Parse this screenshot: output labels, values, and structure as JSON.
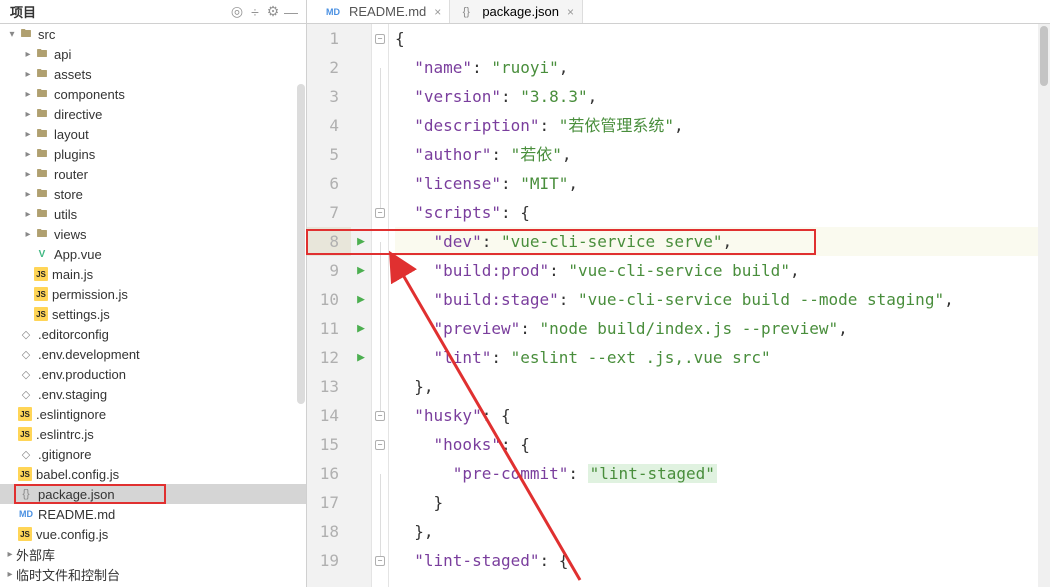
{
  "sidebar_title": "项目",
  "tabs": [
    {
      "label": "README.md",
      "icon": "md"
    },
    {
      "label": "package.json",
      "icon": "json",
      "active": true
    }
  ],
  "tree": [
    {
      "depth": 0,
      "icon": "folder",
      "label": "src",
      "expand": true
    },
    {
      "depth": 1,
      "icon": "folder",
      "label": "api",
      "arrow": true
    },
    {
      "depth": 1,
      "icon": "folder",
      "label": "assets",
      "arrow": true
    },
    {
      "depth": 1,
      "icon": "folder",
      "label": "components",
      "arrow": true
    },
    {
      "depth": 1,
      "icon": "folder",
      "label": "directive",
      "arrow": true
    },
    {
      "depth": 1,
      "icon": "folder",
      "label": "layout",
      "arrow": true
    },
    {
      "depth": 1,
      "icon": "folder",
      "label": "plugins",
      "arrow": true
    },
    {
      "depth": 1,
      "icon": "folder",
      "label": "router",
      "arrow": true
    },
    {
      "depth": 1,
      "icon": "folder",
      "label": "store",
      "arrow": true
    },
    {
      "depth": 1,
      "icon": "folder",
      "label": "utils",
      "arrow": true
    },
    {
      "depth": 1,
      "icon": "folder",
      "label": "views",
      "arrow": true
    },
    {
      "depth": 1,
      "icon": "vue",
      "label": "App.vue"
    },
    {
      "depth": 1,
      "icon": "js",
      "label": "main.js"
    },
    {
      "depth": 1,
      "icon": "js",
      "label": "permission.js"
    },
    {
      "depth": 1,
      "icon": "js",
      "label": "settings.js"
    },
    {
      "depth": 0,
      "icon": "cfg",
      "label": ".editorconfig"
    },
    {
      "depth": 0,
      "icon": "cfg",
      "label": ".env.development"
    },
    {
      "depth": 0,
      "icon": "cfg",
      "label": ".env.production"
    },
    {
      "depth": 0,
      "icon": "cfg",
      "label": ".env.staging"
    },
    {
      "depth": 0,
      "icon": "js",
      "label": ".eslintignore"
    },
    {
      "depth": 0,
      "icon": "js",
      "label": ".eslintrc.js"
    },
    {
      "depth": 0,
      "icon": "cfg",
      "label": ".gitignore"
    },
    {
      "depth": 0,
      "icon": "js",
      "label": "babel.config.js"
    },
    {
      "depth": 0,
      "icon": "json",
      "label": "package.json",
      "selected": true
    },
    {
      "depth": 0,
      "icon": "md",
      "label": "README.md"
    },
    {
      "depth": 0,
      "icon": "js",
      "label": "vue.config.js"
    }
  ],
  "bottom_panels": [
    "外部库",
    "临时文件和控制台"
  ],
  "code_lines": [
    {
      "n": 1,
      "tokens": [
        [
          "brc",
          "{"
        ]
      ],
      "fold": "minus"
    },
    {
      "n": 2,
      "tokens": [
        [
          "indent",
          2
        ],
        [
          "key",
          "\"name\""
        ],
        [
          "punc",
          ": "
        ],
        [
          "str",
          "\"ruoyi\""
        ],
        [
          "punc",
          ","
        ]
      ]
    },
    {
      "n": 3,
      "tokens": [
        [
          "indent",
          2
        ],
        [
          "key",
          "\"version\""
        ],
        [
          "punc",
          ": "
        ],
        [
          "str",
          "\"3.8.3\""
        ],
        [
          "punc",
          ","
        ]
      ]
    },
    {
      "n": 4,
      "tokens": [
        [
          "indent",
          2
        ],
        [
          "key",
          "\"description\""
        ],
        [
          "punc",
          ": "
        ],
        [
          "str",
          "\"若依管理系统\""
        ],
        [
          "punc",
          ","
        ]
      ]
    },
    {
      "n": 5,
      "tokens": [
        [
          "indent",
          2
        ],
        [
          "key",
          "\"author\""
        ],
        [
          "punc",
          ": "
        ],
        [
          "str",
          "\"若依\""
        ],
        [
          "punc",
          ","
        ]
      ]
    },
    {
      "n": 6,
      "tokens": [
        [
          "indent",
          2
        ],
        [
          "key",
          "\"license\""
        ],
        [
          "punc",
          ": "
        ],
        [
          "str",
          "\"MIT\""
        ],
        [
          "punc",
          ","
        ]
      ]
    },
    {
      "n": 7,
      "tokens": [
        [
          "indent",
          2
        ],
        [
          "key",
          "\"scripts\""
        ],
        [
          "punc",
          ": "
        ],
        [
          "brc",
          "{"
        ]
      ],
      "fold": "minus"
    },
    {
      "n": 8,
      "tokens": [
        [
          "indent",
          4
        ],
        [
          "key",
          "\"dev\""
        ],
        [
          "punc",
          ": "
        ],
        [
          "str",
          "\"vue-cli-service serve\""
        ],
        [
          "punc",
          ","
        ]
      ],
      "run": true,
      "hl": true
    },
    {
      "n": 9,
      "tokens": [
        [
          "indent",
          4
        ],
        [
          "key",
          "\"build:prod\""
        ],
        [
          "punc",
          ": "
        ],
        [
          "str",
          "\"vue-cli-service build\""
        ],
        [
          "punc",
          ","
        ]
      ],
      "run": true
    },
    {
      "n": 10,
      "tokens": [
        [
          "indent",
          4
        ],
        [
          "key",
          "\"build:stage\""
        ],
        [
          "punc",
          ": "
        ],
        [
          "str",
          "\"vue-cli-service build --mode staging\""
        ],
        [
          "punc",
          ","
        ]
      ],
      "run": true
    },
    {
      "n": 11,
      "tokens": [
        [
          "indent",
          4
        ],
        [
          "key",
          "\"preview\""
        ],
        [
          "punc",
          ": "
        ],
        [
          "str",
          "\"node build/index.js --preview\""
        ],
        [
          "punc",
          ","
        ]
      ],
      "run": true
    },
    {
      "n": 12,
      "tokens": [
        [
          "indent",
          4
        ],
        [
          "key",
          "\"lint\""
        ],
        [
          "punc",
          ": "
        ],
        [
          "str",
          "\"eslint --ext .js,.vue src\""
        ]
      ],
      "run": true
    },
    {
      "n": 13,
      "tokens": [
        [
          "indent",
          2
        ],
        [
          "brc",
          "}"
        ],
        [
          "punc",
          ","
        ]
      ]
    },
    {
      "n": 14,
      "tokens": [
        [
          "indent",
          2
        ],
        [
          "key",
          "\"husky\""
        ],
        [
          "punc",
          ": "
        ],
        [
          "brc",
          "{"
        ]
      ],
      "fold": "minus"
    },
    {
      "n": 15,
      "tokens": [
        [
          "indent",
          4
        ],
        [
          "key",
          "\"hooks\""
        ],
        [
          "punc",
          ": "
        ],
        [
          "brc",
          "{"
        ]
      ],
      "fold": "minus"
    },
    {
      "n": 16,
      "tokens": [
        [
          "indent",
          6
        ],
        [
          "key",
          "\"pre-commit\""
        ],
        [
          "punc",
          ": "
        ],
        [
          "lit",
          "\"lint-staged\""
        ]
      ]
    },
    {
      "n": 17,
      "tokens": [
        [
          "indent",
          4
        ],
        [
          "brc",
          "}"
        ]
      ]
    },
    {
      "n": 18,
      "tokens": [
        [
          "indent",
          2
        ],
        [
          "brc",
          "}"
        ],
        [
          "punc",
          ","
        ]
      ]
    },
    {
      "n": 19,
      "tokens": [
        [
          "indent",
          2
        ],
        [
          "key",
          "\"lint-staged\""
        ],
        [
          "punc",
          ": "
        ],
        [
          "brc",
          "{"
        ]
      ],
      "fold": "minus"
    }
  ]
}
